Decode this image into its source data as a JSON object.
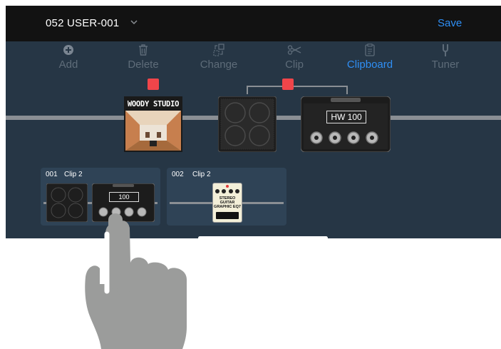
{
  "header": {
    "preset_name": "052 USER-001",
    "save_label": "Save"
  },
  "toolbar": {
    "items": [
      {
        "label": "Add",
        "icon": "plus-circle-icon",
        "active": false
      },
      {
        "label": "Delete",
        "icon": "trash-icon",
        "active": false
      },
      {
        "label": "Change",
        "icon": "swap-icon",
        "active": false
      },
      {
        "label": "Clip",
        "icon": "scissors-icon",
        "active": false
      },
      {
        "label": "Clipboard",
        "icon": "clipboard-icon",
        "active": true
      },
      {
        "label": "Tuner",
        "icon": "tuning-fork-icon",
        "active": false
      }
    ]
  },
  "chain": {
    "blocks": [
      {
        "type": "room",
        "label": "WOODY STUDIO"
      },
      {
        "type": "cabinet",
        "label": ""
      },
      {
        "type": "amp",
        "label": "HW 100"
      }
    ]
  },
  "clipboard": {
    "clips": [
      {
        "number": "001",
        "name": "Clip 2",
        "amp_label": "100"
      },
      {
        "number": "002",
        "name": "Clip 2",
        "pedal_label_1": "STEREO",
        "pedal_label_2": "GUITAR",
        "pedal_label_3": "GRAPHIC EQ7"
      }
    ]
  },
  "colors": {
    "accent": "#2f8ff5",
    "selection": "#f0454a",
    "topbar": "#121212",
    "background": "#263645"
  }
}
